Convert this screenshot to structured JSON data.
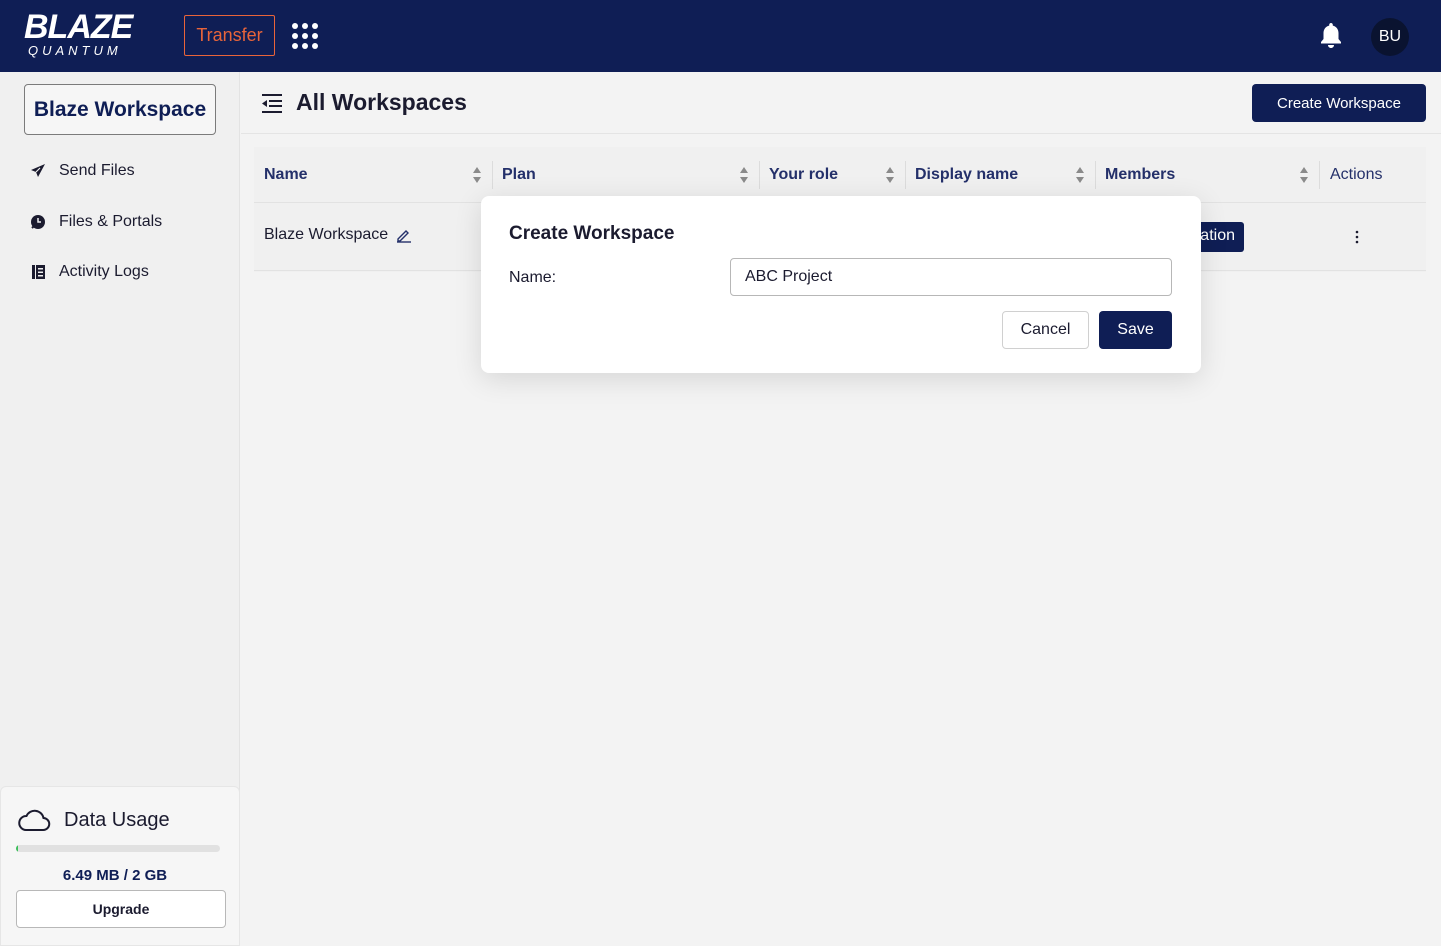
{
  "header": {
    "logo_main": "BLAZE",
    "logo_sub": "QUANTUM",
    "transfer_label": "Transfer",
    "avatar_initials": "BU",
    "colors": {
      "navy": "#0f1e55",
      "accent": "#e8643a"
    }
  },
  "sidebar": {
    "workspace_label": "Blaze Workspace",
    "items": [
      {
        "label": "Send Files",
        "icon": "send-icon"
      },
      {
        "label": "Files & Portals",
        "icon": "portal-icon"
      },
      {
        "label": "Activity Logs",
        "icon": "activity-log-icon"
      }
    ],
    "usage": {
      "title": "Data Usage",
      "text": "6.49 MB / 2 GB",
      "fraction": 0.003,
      "upgrade_label": "Upgrade"
    }
  },
  "main": {
    "title": "All Workspaces",
    "create_label": "Create Workspace",
    "table": {
      "columns": [
        "Name",
        "Plan",
        "Your role",
        "Display name",
        "Members",
        "Actions"
      ],
      "rows": [
        {
          "name": "Blaze Workspace",
          "members_badge": "ation"
        }
      ]
    }
  },
  "modal": {
    "title": "Create Workspace",
    "name_label": "Name:",
    "name_value": "ABC Project",
    "cancel_label": "Cancel",
    "save_label": "Save"
  }
}
